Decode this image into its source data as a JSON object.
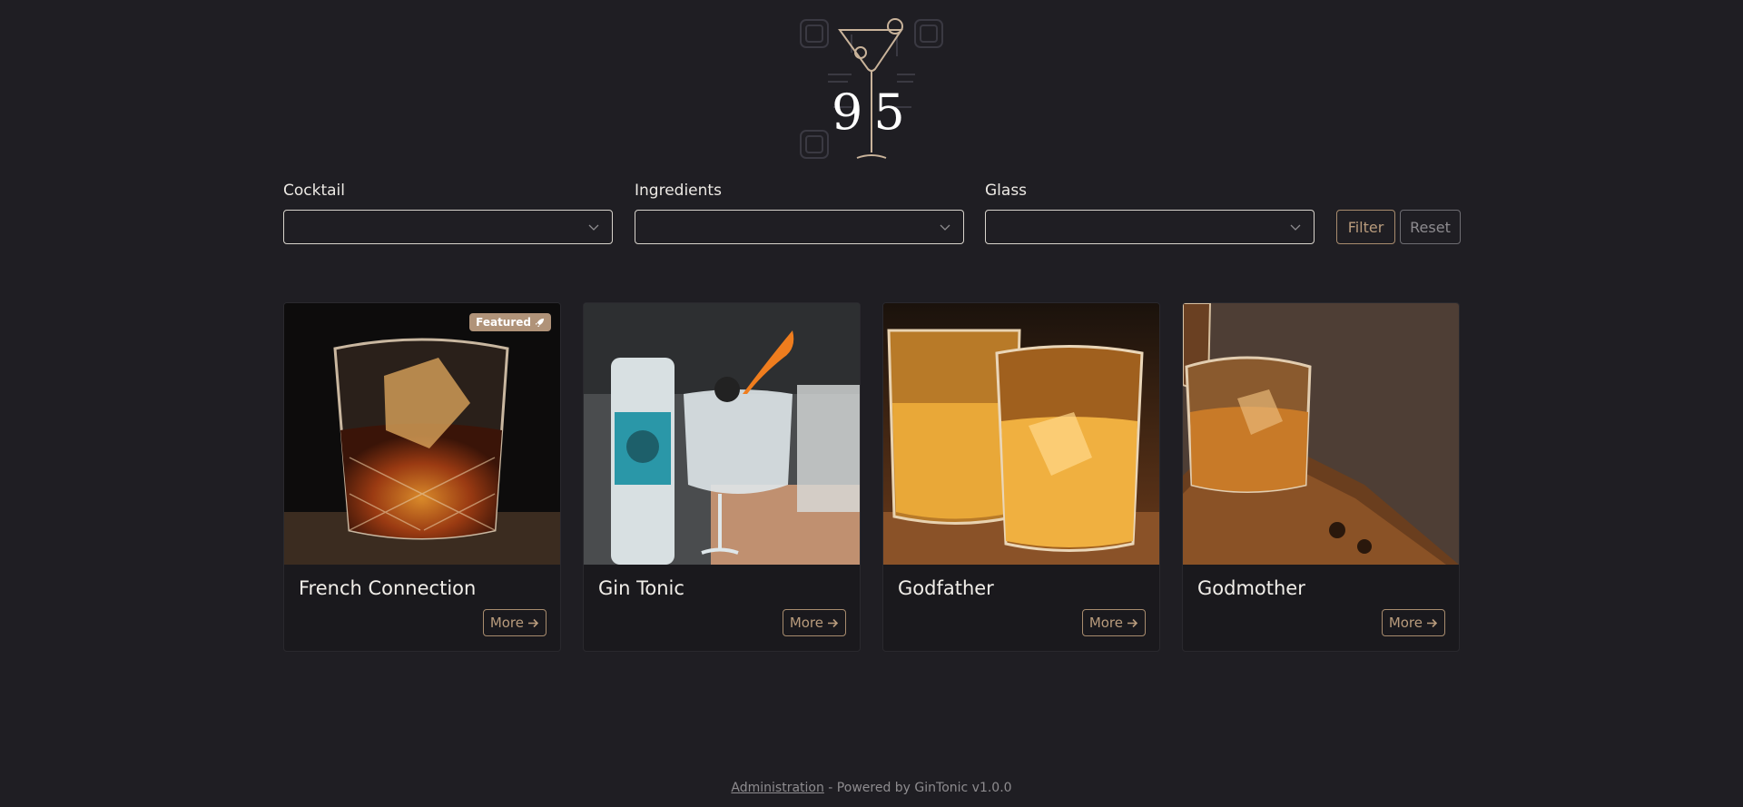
{
  "logo": {
    "text": "95",
    "icon": "cocktail-glass-logo"
  },
  "filters": {
    "cocktail_label": "Cocktail",
    "ingredients_label": "Ingredients",
    "glass_label": "Glass",
    "cocktail_value": "",
    "ingredients_value": "",
    "glass_value": "",
    "filter_button": "Filter",
    "reset_button": "Reset"
  },
  "cards": [
    {
      "title": "French Connection",
      "more": "More",
      "featured": "Featured",
      "image": "whiskey-glass-ice-dark-wood"
    },
    {
      "title": "Gin Tonic",
      "more": "More",
      "image": "gin-tonic-bottle-orange-peel"
    },
    {
      "title": "Godfather",
      "more": "More",
      "image": "two-whiskey-glasses"
    },
    {
      "title": "Godmother",
      "more": "More",
      "image": "whiskey-glass-wooden-board"
    }
  ],
  "footer": {
    "admin_link": "Administration",
    "powered_by": " - Powered by GinTonic v1.0.0"
  },
  "colors": {
    "background": "#1f1e23",
    "accent": "#b09379",
    "card_bg": "#1a191d"
  }
}
